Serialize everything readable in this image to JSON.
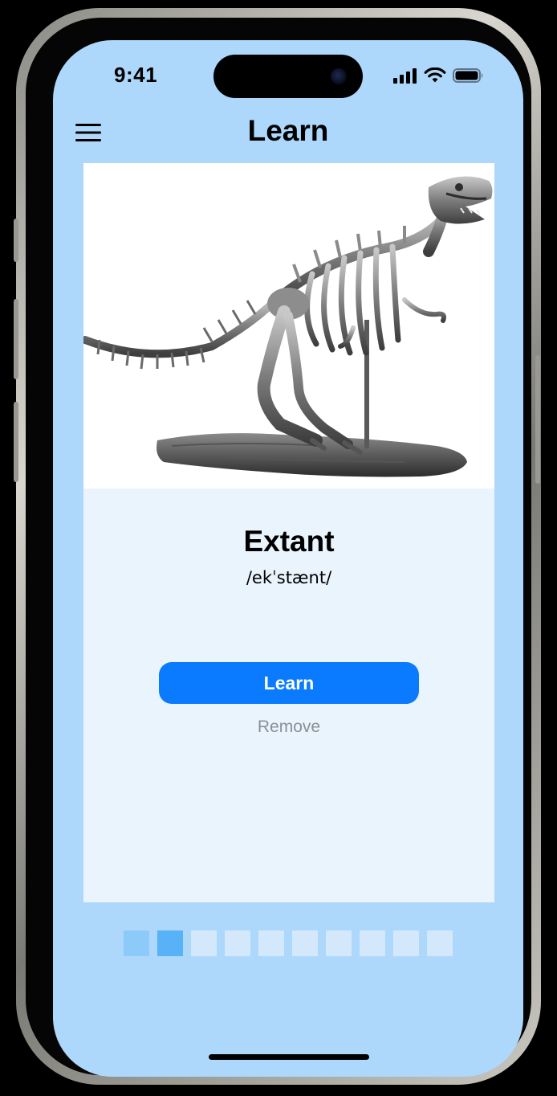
{
  "status_bar": {
    "time": "9:41",
    "icons": [
      "cellular-signal-icon",
      "wifi-icon",
      "battery-icon"
    ]
  },
  "header": {
    "title": "Learn",
    "menu_icon": "hamburger-menu-icon"
  },
  "card": {
    "image_subject": "dinosaur-skeleton",
    "word": "Extant",
    "pronunciation": "/ekˈstænt/",
    "learn_label": "Learn",
    "remove_label": "Remove"
  },
  "pager": {
    "total": 10,
    "current_index": 1,
    "completed_count": 1
  },
  "colors": {
    "screen_background": "#add8fb",
    "card_background": "#eaf4fd",
    "primary_button": "#0a7bff",
    "remove_text": "#8a8f96",
    "pager_done": "#8ccaf9",
    "pager_current": "#59b1f8",
    "pager_upcoming": "#d3e8fb"
  }
}
